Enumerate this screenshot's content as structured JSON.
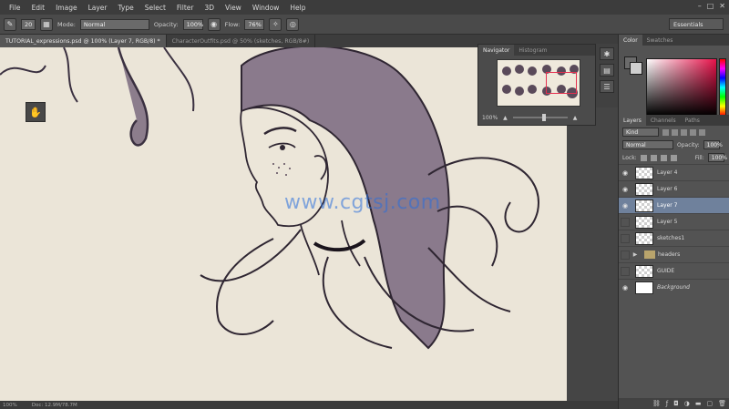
{
  "menu": [
    "File",
    "Edit",
    "Image",
    "Layer",
    "Type",
    "Select",
    "Filter",
    "3D",
    "View",
    "Window",
    "Help"
  ],
  "window_controls": [
    "–",
    "□",
    "✕"
  ],
  "options": {
    "brush_size": "20",
    "mode_label": "Mode:",
    "mode_value": "Normal",
    "opacity_label": "Opacity:",
    "opacity_value": "100%",
    "flow_label": "Flow:",
    "flow_value": "76%",
    "workspace": "Essentials"
  },
  "doc_tabs": [
    {
      "label": "TUTORIAL_expressions.psd @ 100% (Layer 7, RGB/8) *"
    },
    {
      "label": "CharacterOutfits.psd @ 50% (sketches, RGB/8#)"
    }
  ],
  "watermark": "www.cgtsj.com",
  "status": {
    "zoom": "100%",
    "doc": "Doc: 12.9M/78.7M"
  },
  "navigator": {
    "tabs": [
      "Navigator",
      "Histogram"
    ],
    "zoom": "100%"
  },
  "color_panel": {
    "tabs": [
      "Color",
      "Swatches"
    ],
    "accent": "#e8124a"
  },
  "layers_panel": {
    "tabs": [
      "Layers",
      "Channels",
      "Paths"
    ],
    "filter_kind": "Kind",
    "blend_mode": "Normal",
    "opacity_label": "Opacity:",
    "opacity_value": "100%",
    "lock_label": "Lock:",
    "fill_label": "Fill:",
    "fill_value": "100%",
    "layers": [
      {
        "name": "Layer 4",
        "visible": true,
        "selected": false,
        "type": "layer"
      },
      {
        "name": "Layer 6",
        "visible": true,
        "selected": false,
        "type": "layer"
      },
      {
        "name": "Layer 7",
        "visible": true,
        "selected": true,
        "type": "layer"
      },
      {
        "name": "Layer 5",
        "visible": false,
        "selected": false,
        "type": "layer"
      },
      {
        "name": "sketches1",
        "visible": false,
        "selected": false,
        "type": "layer"
      },
      {
        "name": "headers",
        "visible": false,
        "selected": false,
        "type": "group"
      },
      {
        "name": "GUIDE",
        "visible": false,
        "selected": false,
        "type": "layer"
      },
      {
        "name": "Background",
        "visible": true,
        "selected": false,
        "type": "background"
      }
    ]
  }
}
